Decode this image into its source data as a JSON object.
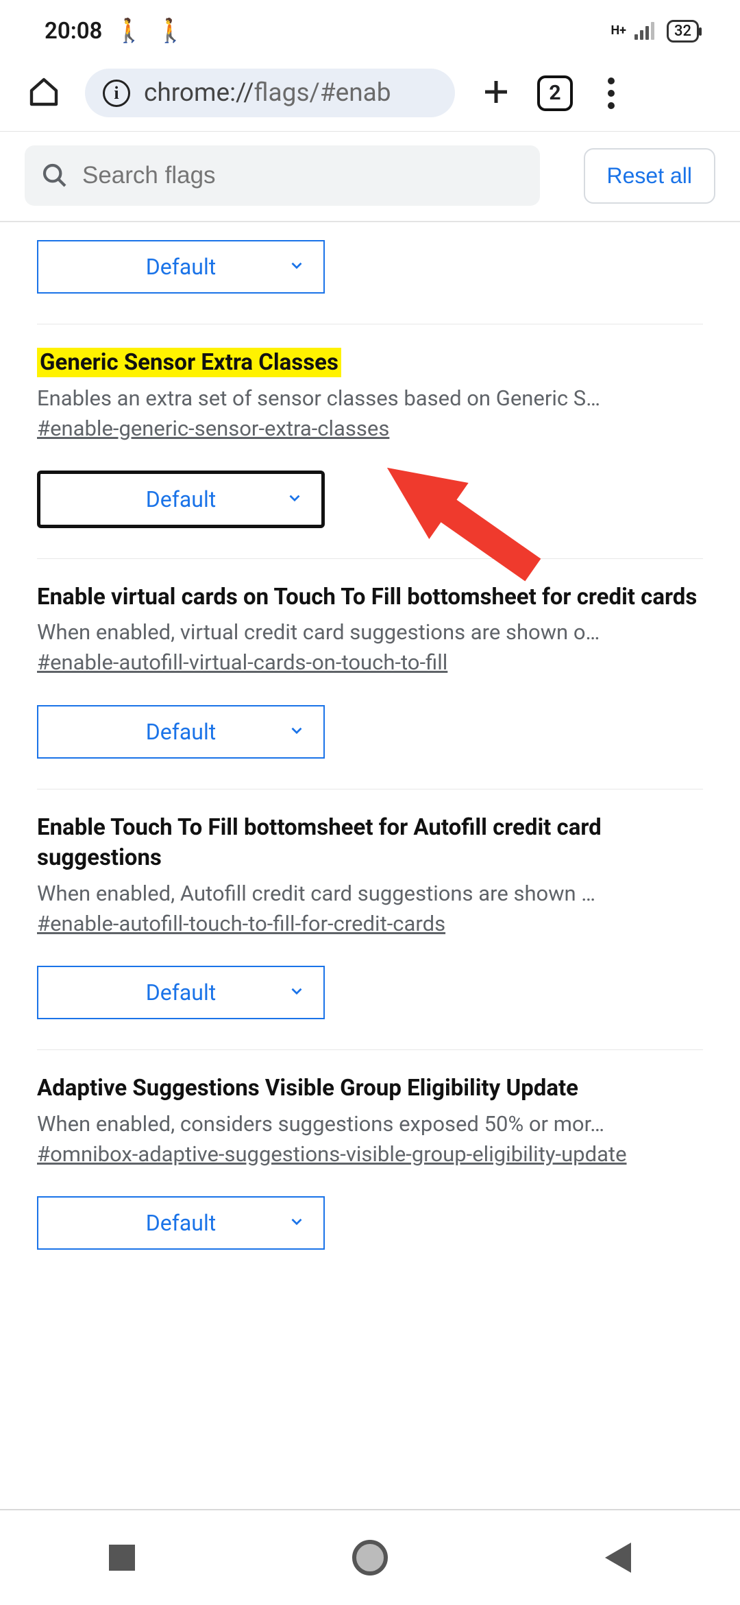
{
  "status": {
    "time": "20:08",
    "network": "H+",
    "battery": "32"
  },
  "browser": {
    "url_host": "chrome://",
    "url_path": "flags/#enab",
    "tab_count": "2"
  },
  "search": {
    "placeholder": "Search flags",
    "reset_label": "Reset all"
  },
  "flags": [
    {
      "title": "",
      "desc": "",
      "hash": "",
      "dropdown": "Default",
      "highlighted": false,
      "partial_top": true
    },
    {
      "title": "Generic Sensor Extra Classes",
      "desc": "Enables an extra set of sensor classes based on Generic S…",
      "hash": "#enable-generic-sensor-extra-classes",
      "dropdown": "Default",
      "highlighted": true,
      "focused": true
    },
    {
      "title": "Enable virtual cards on Touch To Fill bottomsheet for credit cards",
      "desc": "When enabled, virtual credit card suggestions are shown o…",
      "hash": "#enable-autofill-virtual-cards-on-touch-to-fill",
      "dropdown": "Default"
    },
    {
      "title": "Enable Touch To Fill bottomsheet for Autofill credit card suggestions",
      "desc": "When enabled, Autofill credit card suggestions are shown …",
      "hash": "#enable-autofill-touch-to-fill-for-credit-cards",
      "dropdown": "Default"
    },
    {
      "title": "Adaptive Suggestions Visible Group Eligibility Update",
      "desc": "When enabled, considers suggestions exposed 50% or mor…",
      "hash": "#omnibox-adaptive-suggestions-visible-group-eligibility-update",
      "dropdown": "Default"
    }
  ]
}
